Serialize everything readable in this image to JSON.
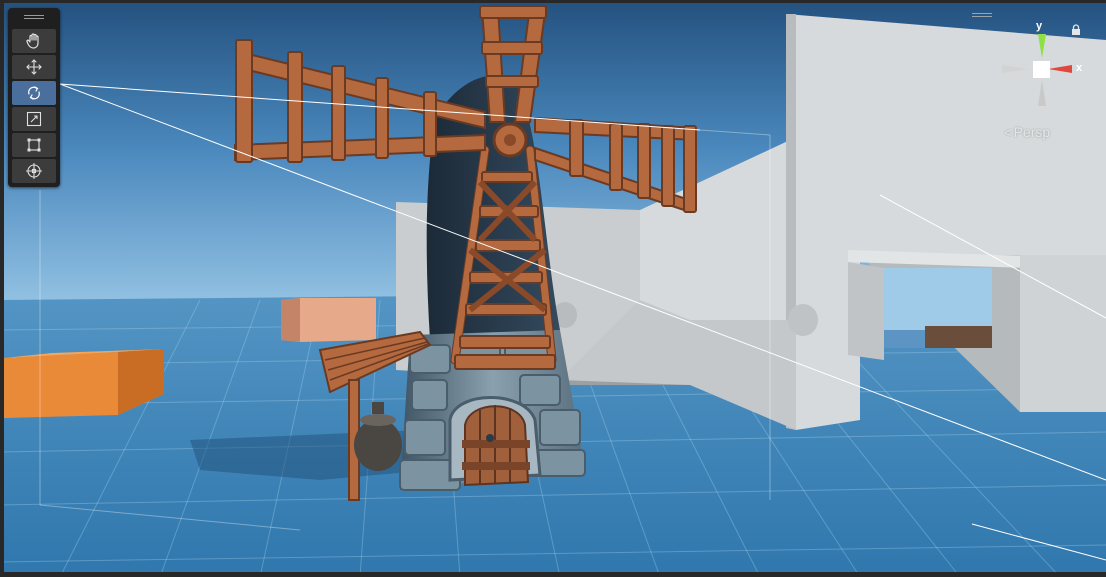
{
  "scene_view": {
    "projection_label": "Persp",
    "projection_arrow": "<"
  },
  "gizmo": {
    "y_label": "y",
    "x_label": "x",
    "colors": {
      "y": "#8ee043",
      "x": "#e0483e",
      "neutral": "#d0d0d0"
    }
  },
  "toolbar": {
    "tools": [
      {
        "name": "hand-tool",
        "icon": "hand-icon"
      },
      {
        "name": "move-tool",
        "icon": "move-arrows-icon"
      },
      {
        "name": "rotate-tool",
        "icon": "rotate-icon",
        "active": true
      },
      {
        "name": "scale-tool",
        "icon": "scale-icon"
      },
      {
        "name": "rect-tool",
        "icon": "rect-transform-icon"
      },
      {
        "name": "transform-tool",
        "icon": "transform-icon"
      }
    ]
  },
  "colors": {
    "sky_top": "#2d5d8f",
    "sky_horizon": "#8dc0e3",
    "ground": "#3e86b8",
    "accent_active": "#4a6f9c"
  }
}
